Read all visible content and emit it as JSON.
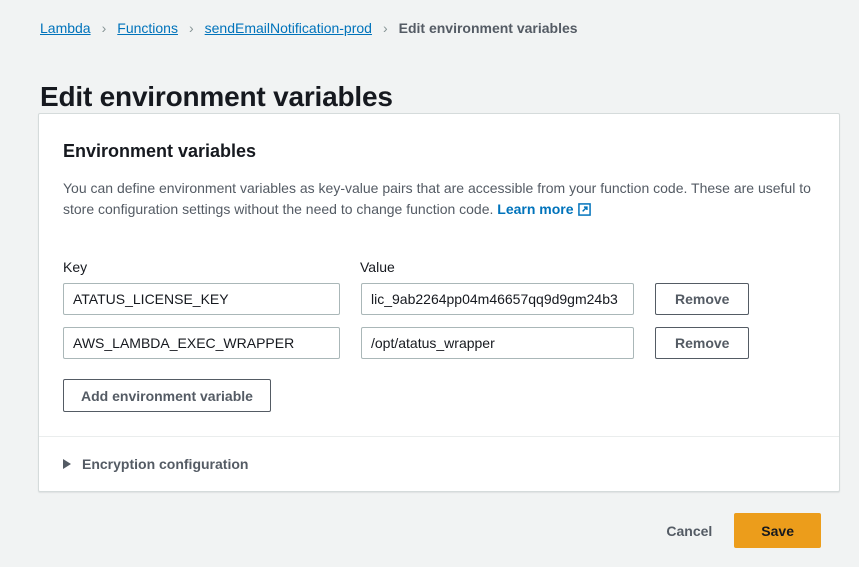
{
  "breadcrumb": {
    "separator": "›",
    "items": [
      {
        "label": "Lambda",
        "type": "link"
      },
      {
        "label": "Functions",
        "type": "link"
      },
      {
        "label": "sendEmailNotification-prod",
        "type": "link"
      },
      {
        "label": "Edit environment variables",
        "type": "current"
      }
    ]
  },
  "page": {
    "title": "Edit environment variables"
  },
  "card": {
    "section_title": "Environment variables",
    "description": "You can define environment variables as key-value pairs that are accessible from your function code. These are useful to store configuration settings without the need to change function code.",
    "learn_more_label": "Learn more",
    "learn_more_icon": "external-link-icon",
    "labels": {
      "key": "Key",
      "value": "Value"
    },
    "variables": [
      {
        "key": "ATATUS_LICENSE_KEY",
        "value": "lic_9ab2264pp04m46657qq9d9gm24b3",
        "remove_label": "Remove"
      },
      {
        "key": "AWS_LAMBDA_EXEC_WRAPPER",
        "value": "/opt/atatus_wrapper",
        "remove_label": "Remove"
      }
    ],
    "add_button_label": "Add environment variable",
    "encryption": {
      "label": "Encryption configuration",
      "caret_icon": "caret-right-icon",
      "expanded": false
    }
  },
  "footer": {
    "cancel_label": "Cancel",
    "save_label": "Save"
  },
  "colors": {
    "accent_orange": "#ec9d1b",
    "link_blue": "#0073bb",
    "page_bg": "#f1f3f3",
    "text_dark": "#16191f",
    "text_muted": "#545b64"
  }
}
